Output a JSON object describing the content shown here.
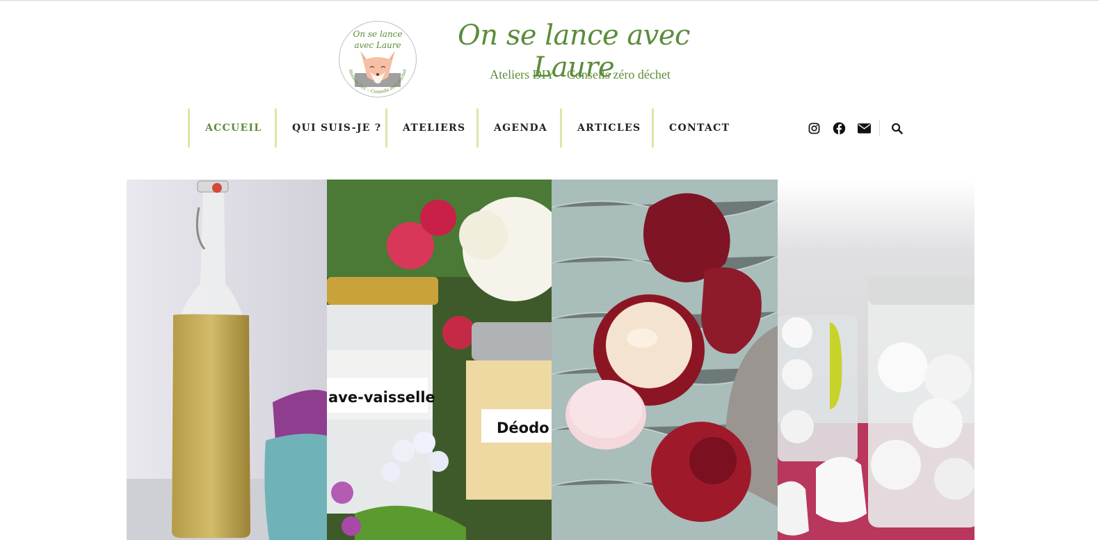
{
  "site": {
    "logo_text": {
      "line1": "On se lance",
      "line2": "avec Laure",
      "ring": "Ateliers DIY – Conseils zéro déchet"
    },
    "title": "On se lance avec Laure",
    "tagline": "Ateliers DIY – Conseils zéro déchet"
  },
  "nav": {
    "items": [
      {
        "label": "ACCUEIL",
        "active": true
      },
      {
        "label": "QUI SUIS-JE ?",
        "active": false
      },
      {
        "label": "ATELIERS",
        "active": false
      },
      {
        "label": "AGENDA",
        "active": false
      },
      {
        "label": "ARTICLES",
        "active": false
      },
      {
        "label": "CONTACT",
        "active": false
      }
    ],
    "social": [
      "instagram-icon",
      "facebook-icon",
      "email-icon"
    ],
    "search": "search-icon"
  },
  "hero": {
    "panel2": {
      "label_left": "ave-vaisselle",
      "label_right": "Déodo"
    }
  },
  "colors": {
    "brand_green": "#5b8c3a",
    "nav_border": "#dbe7a8",
    "text_dark": "#222222"
  }
}
